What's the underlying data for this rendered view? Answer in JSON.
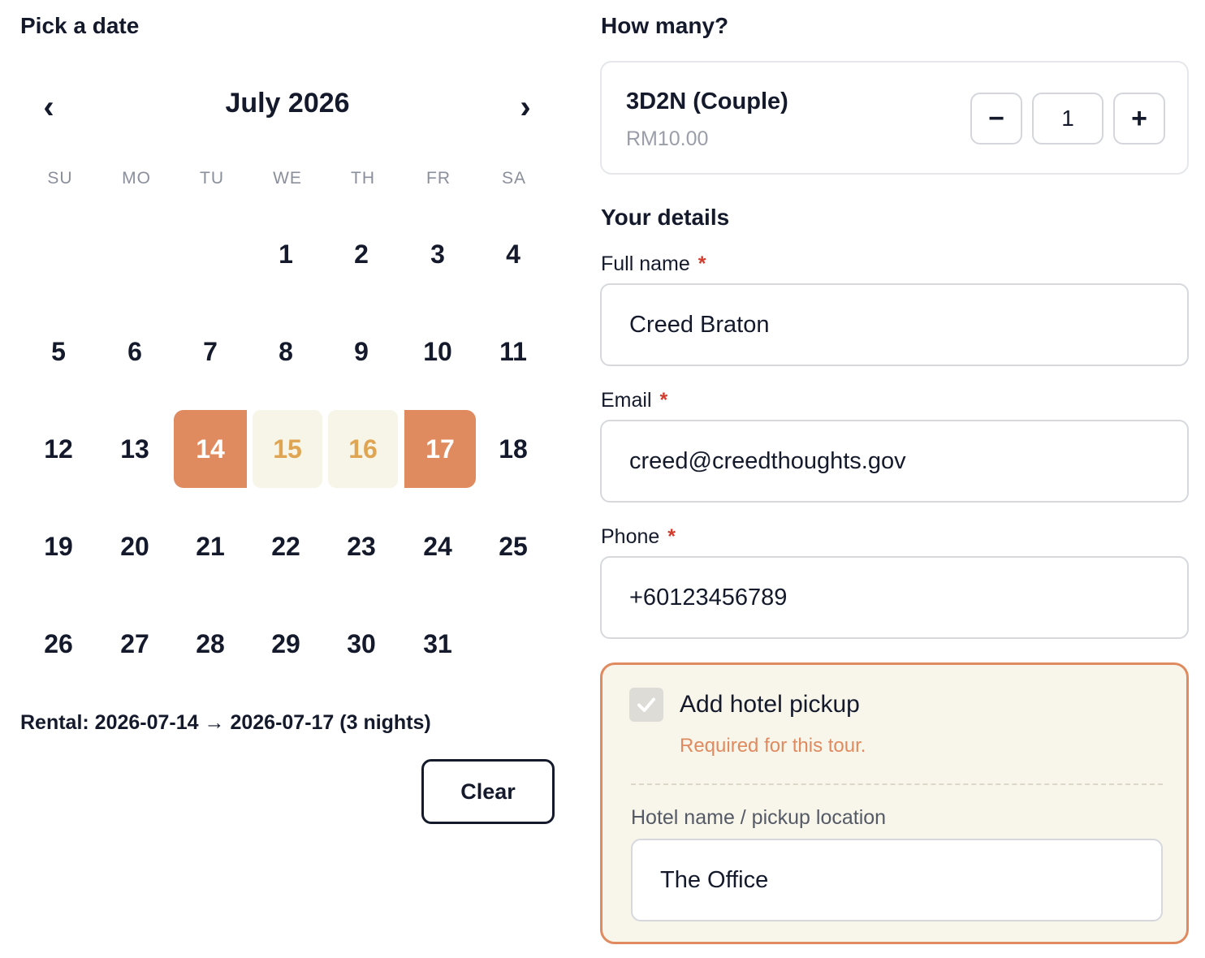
{
  "calendar": {
    "title": "Pick a date",
    "month_label": "July 2026",
    "prev_glyph": "‹",
    "next_glyph": "›",
    "weekdays": [
      "SU",
      "MO",
      "TU",
      "WE",
      "TH",
      "FR",
      "SA"
    ],
    "first_weekday_index": 3,
    "days_in_month": 31,
    "range_start": 14,
    "range_end": 17,
    "rental_summary": "Rental: 2026-07-14 → 2026-07-17 (3 nights)",
    "clear_label": "Clear"
  },
  "quantity": {
    "title": "How many?",
    "package_name": "3D2N (Couple)",
    "package_price": "RM10.00",
    "minus_glyph": "−",
    "plus_glyph": "+",
    "value": "1"
  },
  "details": {
    "title": "Your details",
    "required_marker": "*",
    "full_name_label": "Full name",
    "full_name_value": "Creed Braton",
    "email_label": "Email",
    "email_value": "creed@creedthoughts.gov",
    "phone_label": "Phone",
    "phone_value": "+60123456789"
  },
  "pickup": {
    "checked": true,
    "label": "Add hotel pickup",
    "note": "Required for this tour.",
    "hotel_label": "Hotel name / pickup location",
    "hotel_value": "The Office"
  },
  "colors": {
    "accent": "#e08a5f",
    "range_mid_bg": "#f7f4e8",
    "range_mid_text": "#e0a552",
    "required": "#d33b2c",
    "pickup_bg": "#f8f5ea"
  }
}
